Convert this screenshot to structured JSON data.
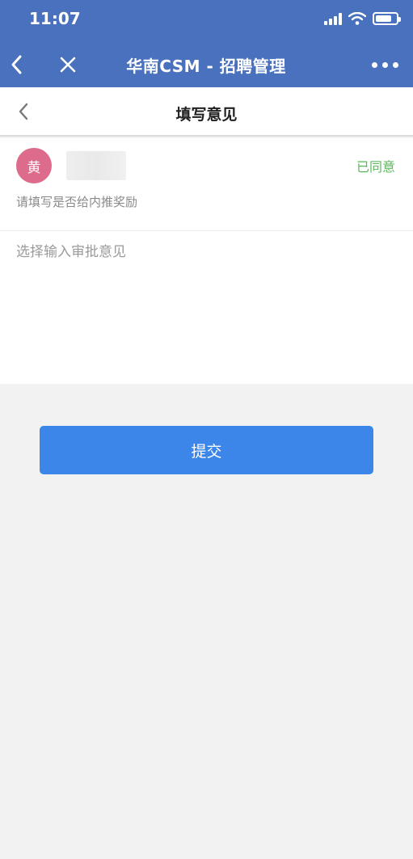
{
  "status_bar": {
    "time": "11:07"
  },
  "header": {
    "title": "华南CSM - 招聘管理"
  },
  "page": {
    "title": "填写意见"
  },
  "approver": {
    "avatar_char": "黄",
    "status": "已同意",
    "prompt": "请填写是否给内推奖励"
  },
  "opinion_input": {
    "placeholder": "选择输入审批意见",
    "value": ""
  },
  "submit": {
    "label": "提交"
  },
  "colors": {
    "header_bg": "#4a71be",
    "avatar_bg": "#dc6b8c",
    "agreed_text": "#5cb85c",
    "button_bg": "#3b86e8"
  },
  "icons": [
    "back-chevron-icon",
    "close-icon",
    "more-dots-icon",
    "signal-icon",
    "wifi-icon",
    "battery-icon"
  ]
}
